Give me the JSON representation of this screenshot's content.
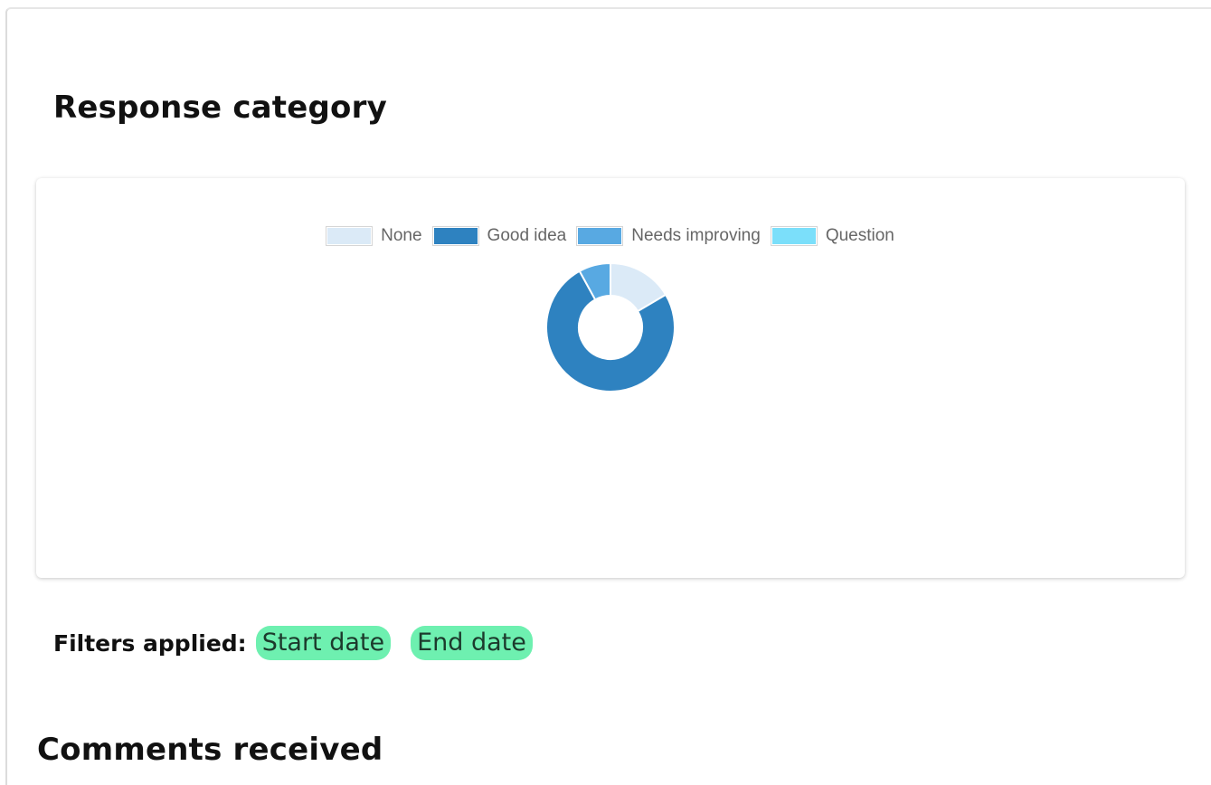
{
  "headings": {
    "response_category": "Response category",
    "comments_received": "Comments received"
  },
  "filters": {
    "label": "Filters applied:",
    "chips": [
      "Start date",
      "End date"
    ]
  },
  "chart_data": {
    "type": "doughnut",
    "title": "",
    "legend_position": "top",
    "categories": [
      "None",
      "Good idea",
      "Needs improving",
      "Question"
    ],
    "values": [
      16.5,
      75.5,
      8,
      0
    ],
    "colors": [
      "#dbeaf7",
      "#2e82c0",
      "#58a9e2",
      "#7bdffa"
    ]
  }
}
